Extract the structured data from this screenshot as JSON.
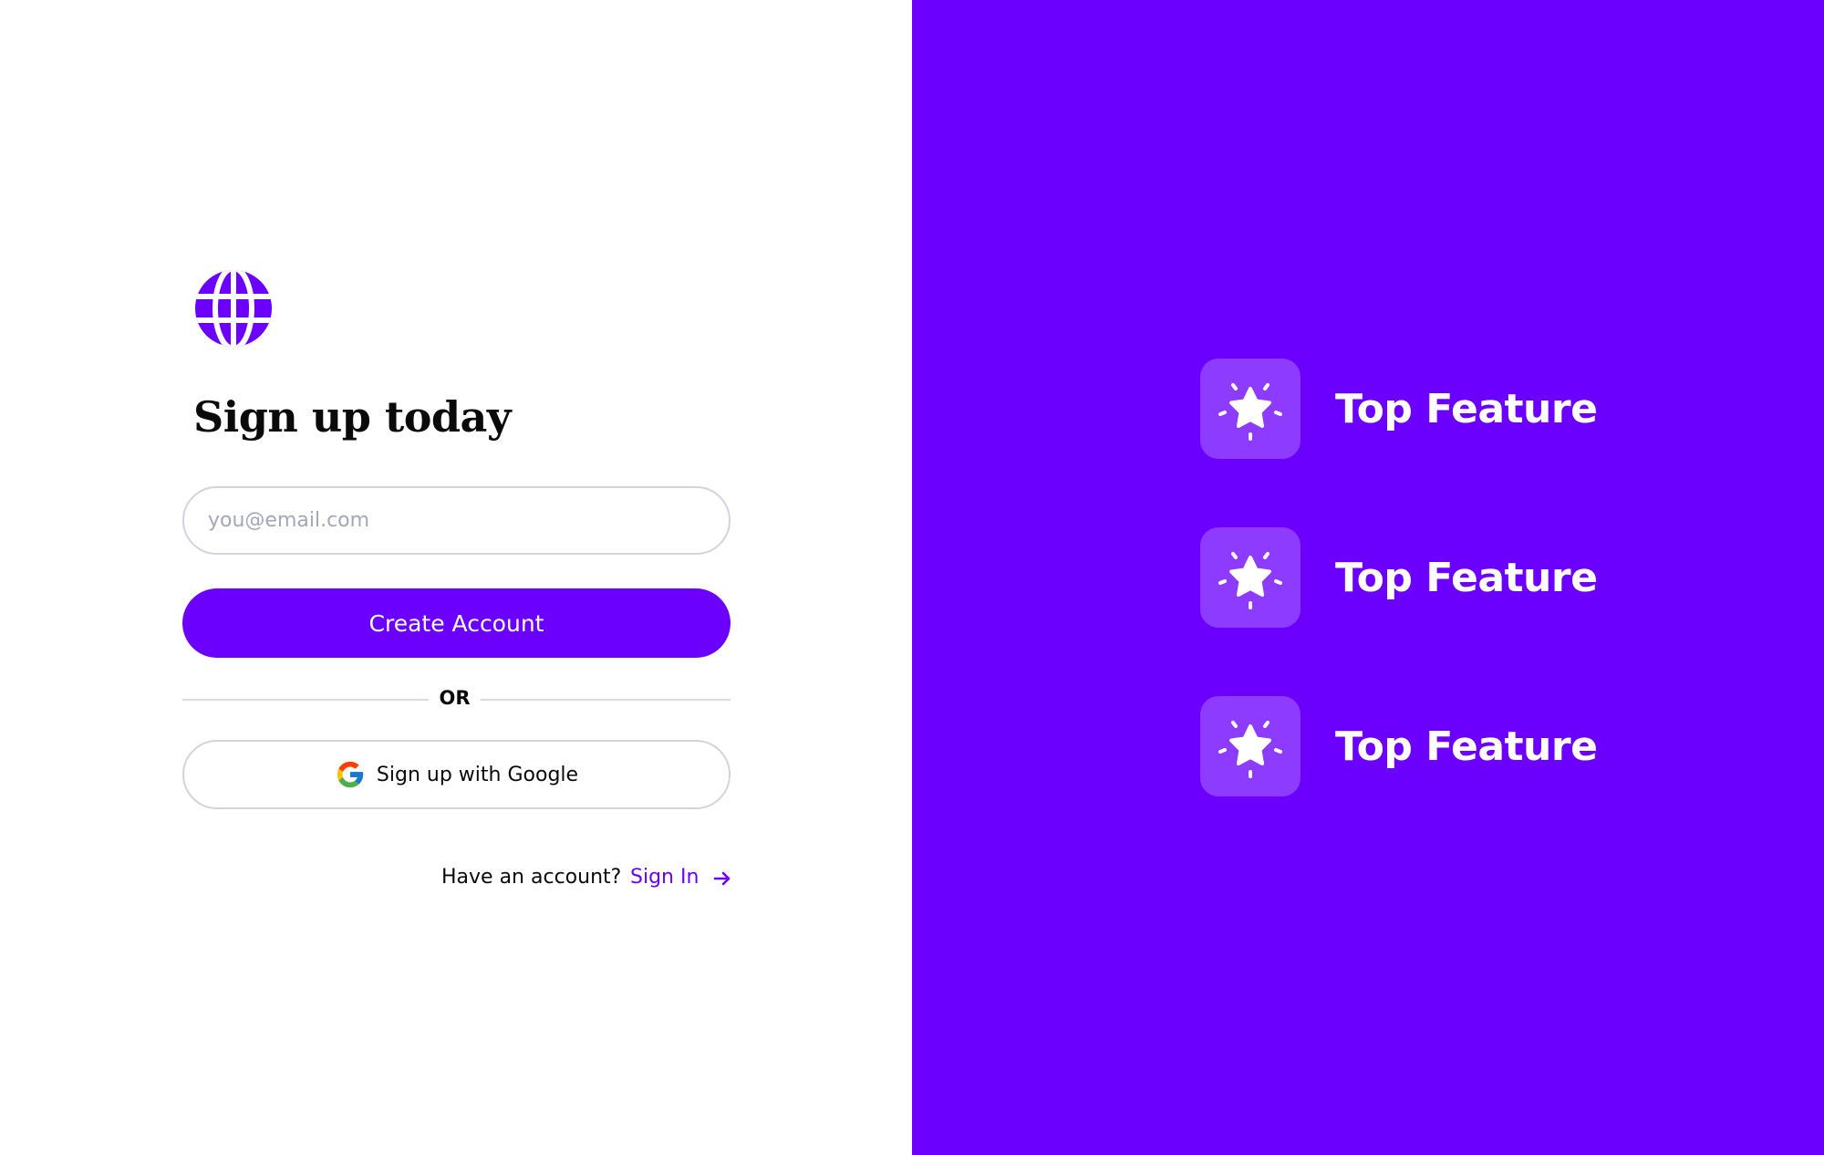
{
  "signup": {
    "title": "Sign up today",
    "email_placeholder": "you@email.com",
    "create_button": "Create Account",
    "or_text": "OR",
    "google_button": "Sign up with Google",
    "have_account": "Have an account?",
    "signin_link": "Sign In"
  },
  "features": [
    {
      "label": "Top Feature",
      "icon": "star-sparkle-icon"
    },
    {
      "label": "Top Feature",
      "icon": "star-sparkle-icon"
    },
    {
      "label": "Top Feature",
      "icon": "star-sparkle-icon"
    }
  ],
  "icons": {
    "logo": "globe-icon",
    "google": "google-icon",
    "arrow": "arrow-right-icon"
  },
  "colors": {
    "brand": "#6c00ff",
    "feature_tile": "#8c3bff",
    "border": "#d3d3df",
    "placeholder": "#a3a7b7",
    "text": "#0a0a0a",
    "white": "#ffffff"
  }
}
